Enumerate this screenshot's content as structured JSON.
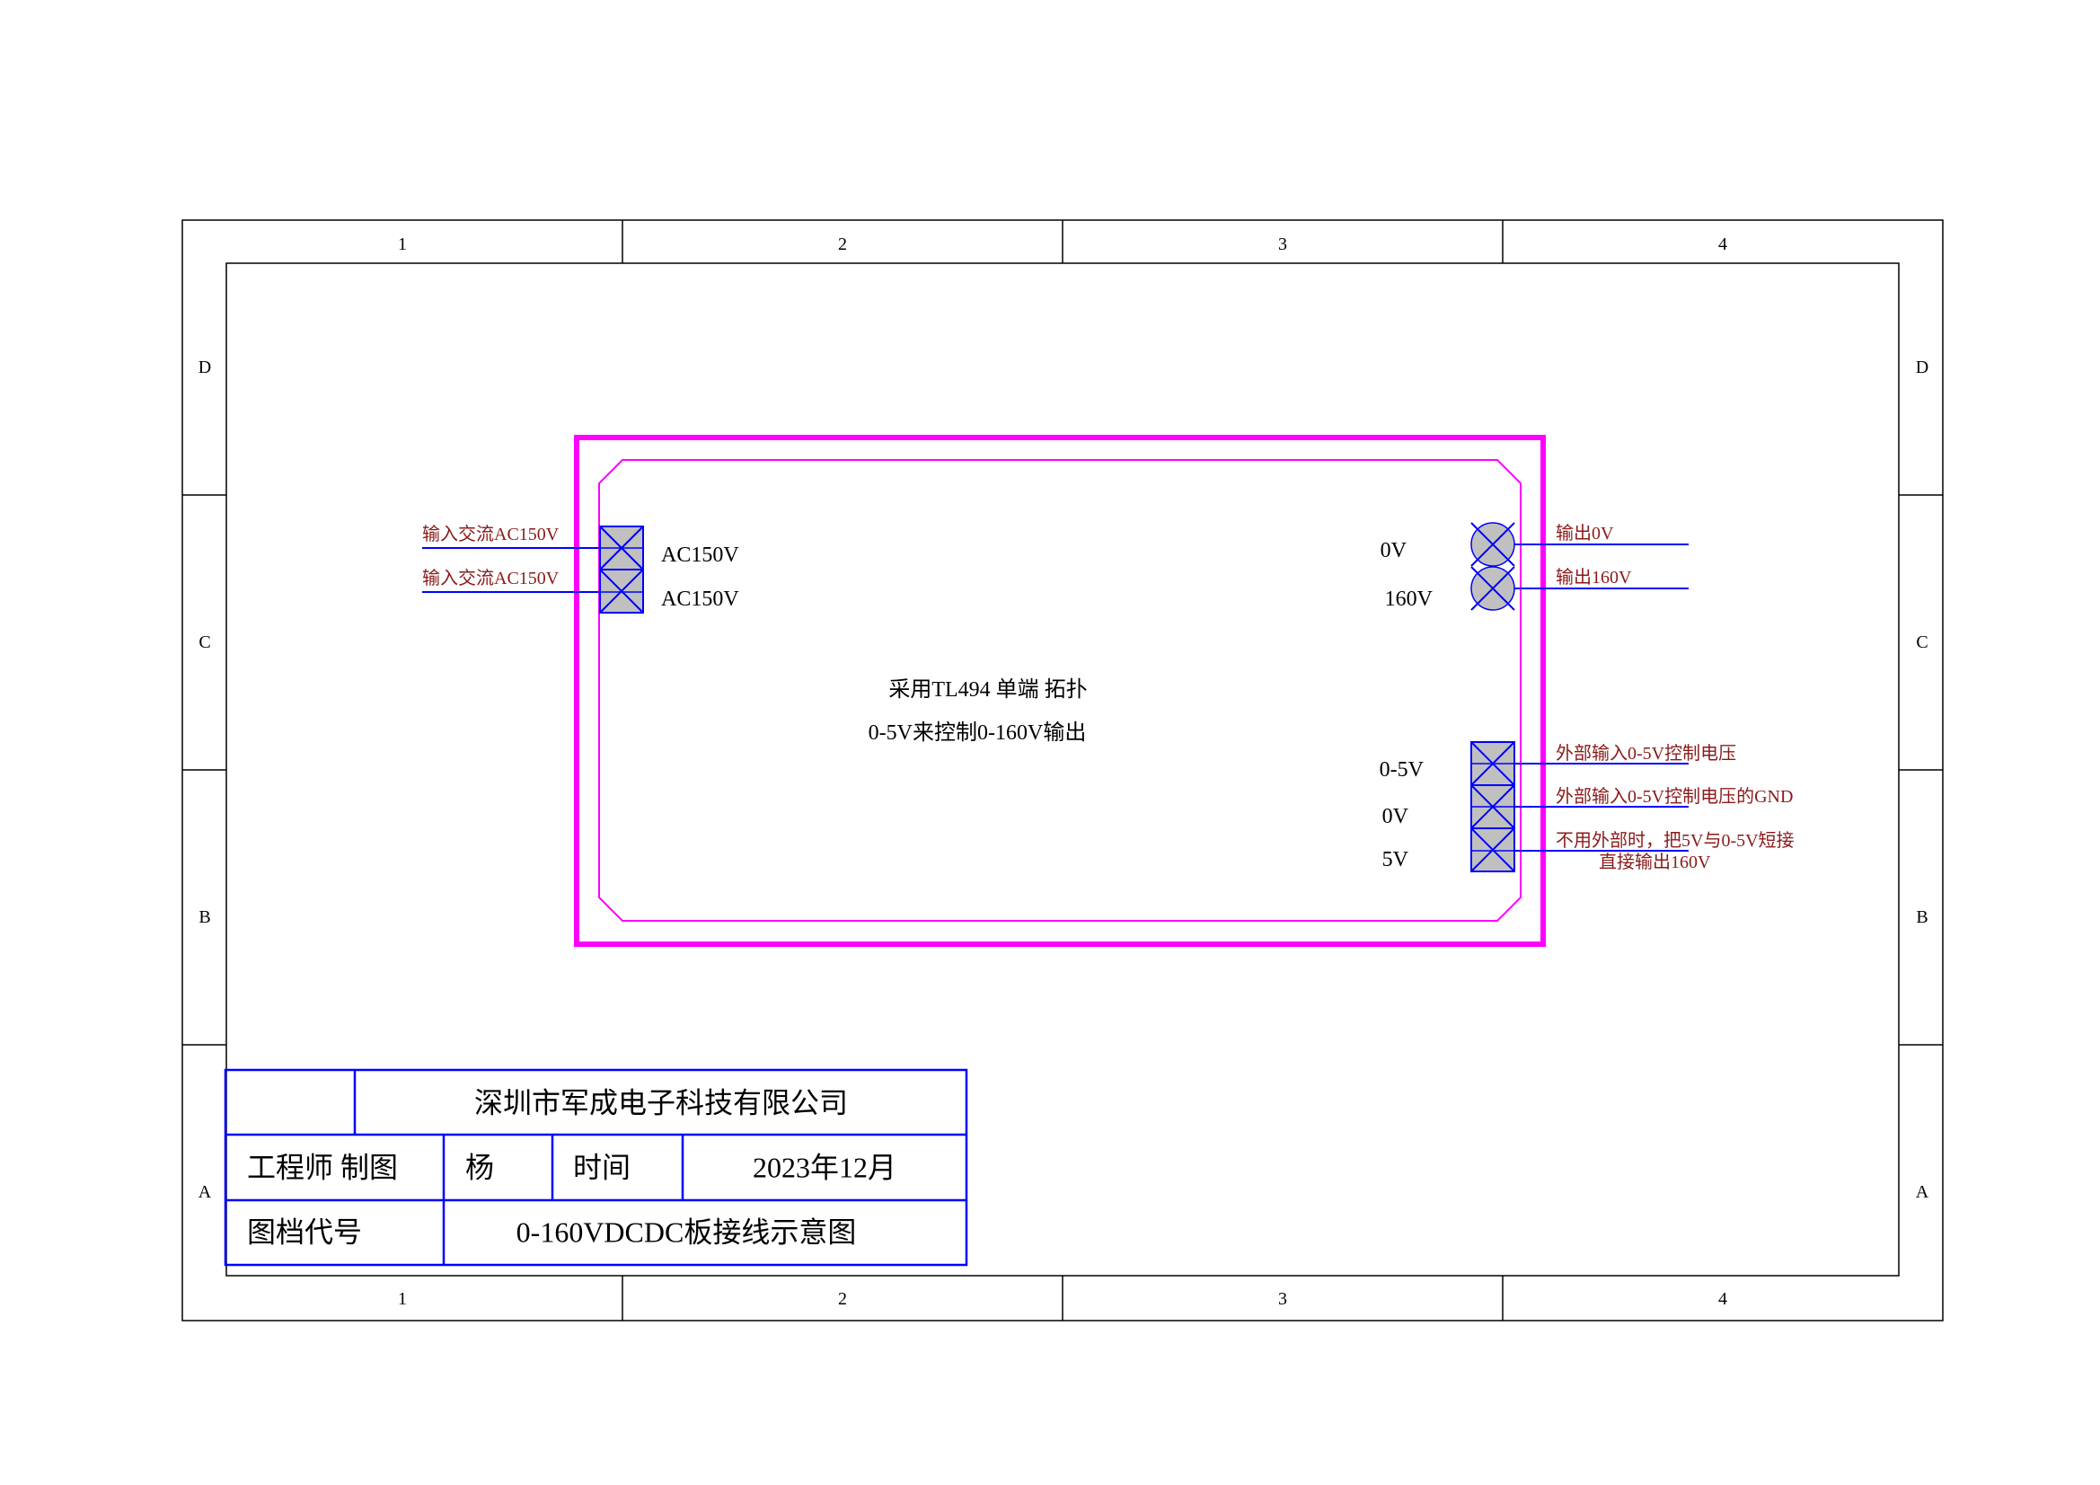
{
  "frame": {
    "columns": [
      "1",
      "2",
      "3",
      "4"
    ],
    "rows": [
      "D",
      "C",
      "B",
      "A"
    ]
  },
  "board": {
    "note_line1": "采用TL494 单端 拓扑",
    "note_line2": "0-5V来控制0-160V输出"
  },
  "input_connector": {
    "pins": [
      {
        "label": "AC150V",
        "wire_label": "输入交流AC150V"
      },
      {
        "label": "AC150V",
        "wire_label": "输入交流AC150V"
      }
    ]
  },
  "output_connector": {
    "pins": [
      {
        "label": "0V",
        "wire_label": "输出0V"
      },
      {
        "label": "160V",
        "wire_label": "输出160V"
      }
    ]
  },
  "control_connector": {
    "pins": [
      {
        "label": "0-5V",
        "wire_label": "外部输入0-5V控制电压"
      },
      {
        "label": "0V",
        "wire_label": "外部输入0-5V控制电压的GND"
      },
      {
        "label": "5V",
        "wire_label": "不用外部时，把5V与0-5V短接"
      }
    ],
    "extra_note": "直接输出160V"
  },
  "title_block": {
    "company": "深圳市军成电子科技有限公司",
    "engineer_label": "工程师 制图",
    "engineer_name": "杨",
    "time_label": "时间",
    "time_value": "2023年12月",
    "doc_label": "图档代号",
    "doc_title": "0-160VDCDC板接线示意图"
  },
  "colors": {
    "frame": "#000000",
    "board_outline": "#ff00ff",
    "wire": "#0000ff",
    "wire_label": "#8b1a1a",
    "pin_fill": "#c0c0c0"
  }
}
